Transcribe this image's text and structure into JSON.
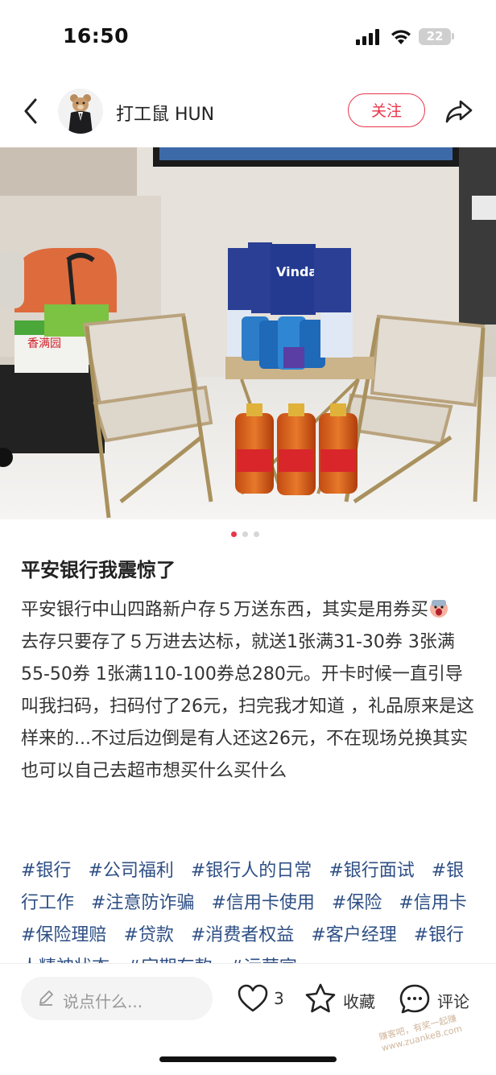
{
  "status_bar": {
    "time": "16:50",
    "battery": "22"
  },
  "header": {
    "username": "打工鼠 HUN",
    "follow_label": "关注"
  },
  "carousel": {
    "total": 3,
    "active_index": 0
  },
  "post": {
    "title": "平安银行我震惊了",
    "body_p1": "平安银行中山四路新户存５万送东西，其实是用券买",
    "body_p2": "去存只要存了５万进去达标，就送1张满31-30券 3张满55-50券  1张满110-100券总280元。开卡时候一直引导叫我扫码，扫码付了26元，扫完我才知道 ，礼品原来是这样来的...不过后边倒是有人还这26元，不在现场兑换其实也可以自己去超市想买什么买什么",
    "tags": [
      "#银行",
      "#公司福利",
      "#银行人的日常",
      "#银行面试",
      "#银行工作",
      "#注意防诈骗",
      "#信用卡使用",
      "#保险",
      "#信用卡",
      "#保险理赔",
      "#贷款",
      "#消费者权益",
      "#客户经理",
      "#银行人精神状态",
      "#定期存款",
      "#运营官"
    ]
  },
  "bottom_bar": {
    "comment_placeholder": "说点什么...",
    "like_count": "3",
    "collect_label": "收藏",
    "comment_label": "评论",
    "watermark": "赚客吧，有奖一起赚 www.zuanke8.com"
  },
  "colors": {
    "accent": "#e8354a",
    "tag": "#2e4f84",
    "dot_active": "#e8354a",
    "dot_inactive": "#d6d6d6"
  }
}
